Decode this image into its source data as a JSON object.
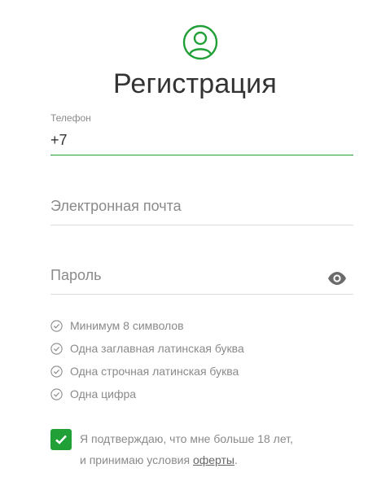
{
  "colors": {
    "accent": "#21a038",
    "muted_text": "#8a8a8a",
    "title_text": "#333333",
    "divider": "#dcdcdc"
  },
  "header": {
    "icon": "user-circle-icon",
    "title": "Регистрация"
  },
  "form": {
    "phone": {
      "label": "Телефон",
      "value": "+7"
    },
    "email": {
      "placeholder": "Электронная почта",
      "value": ""
    },
    "password": {
      "placeholder": "Пароль",
      "value": "",
      "toggle_icon": "eye-icon"
    }
  },
  "password_rules": [
    {
      "text": "Минимум 8 символов",
      "icon": "check-circle-icon"
    },
    {
      "text": "Одна заглавная латинская буква",
      "icon": "check-circle-icon"
    },
    {
      "text": "Одна строчная латинская буква",
      "icon": "check-circle-icon"
    },
    {
      "text": "Одна цифра",
      "icon": "check-circle-icon"
    }
  ],
  "agreement": {
    "checked": true,
    "line1": "Я подтверждаю, что мне больше 18 лет,",
    "line2_prefix": "и принимаю условия ",
    "link": "оферты",
    "line2_suffix": "."
  }
}
